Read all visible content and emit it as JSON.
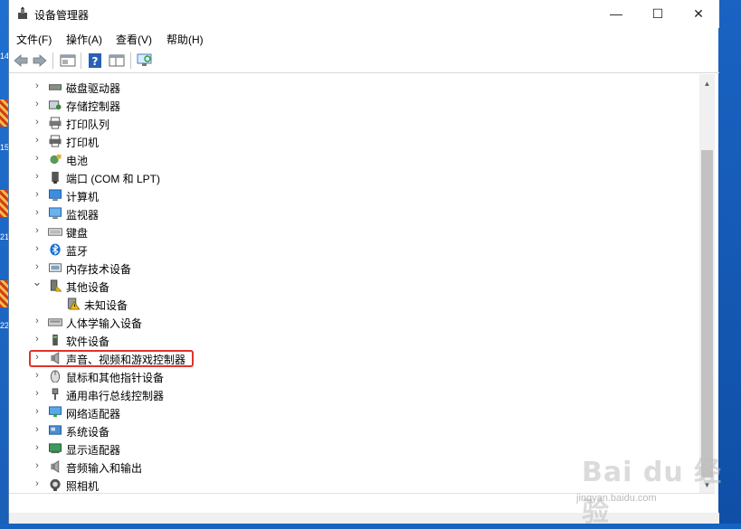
{
  "window": {
    "title": "设备管理器",
    "controls": {
      "minimize": "—",
      "maximize": "☐",
      "close": "✕"
    }
  },
  "menu": [
    {
      "label": "文件(F)"
    },
    {
      "label": "操作(A)"
    },
    {
      "label": "查看(V)"
    },
    {
      "label": "帮助(H)"
    }
  ],
  "toolbar": {
    "icons": [
      "back-arrow-icon",
      "forward-arrow-icon",
      "properties-icon",
      "help-icon",
      "console-view-icon",
      "scan-hardware-icon"
    ]
  },
  "tree": [
    {
      "label": "磁盘驱动器",
      "icon": "disk-drive-icon",
      "expanded": false
    },
    {
      "label": "存储控制器",
      "icon": "storage-controller-icon",
      "expanded": false
    },
    {
      "label": "打印队列",
      "icon": "print-queue-icon",
      "expanded": false
    },
    {
      "label": "打印机",
      "icon": "printer-icon",
      "expanded": false
    },
    {
      "label": "电池",
      "icon": "battery-icon",
      "expanded": false
    },
    {
      "label": "端口 (COM 和 LPT)",
      "icon": "port-icon",
      "expanded": false
    },
    {
      "label": "计算机",
      "icon": "computer-icon",
      "expanded": false
    },
    {
      "label": "监视器",
      "icon": "monitor-icon",
      "expanded": false
    },
    {
      "label": "键盘",
      "icon": "keyboard-icon",
      "expanded": false
    },
    {
      "label": "蓝牙",
      "icon": "bluetooth-icon",
      "expanded": false
    },
    {
      "label": "内存技术设备",
      "icon": "memory-device-icon",
      "expanded": false
    },
    {
      "label": "其他设备",
      "icon": "other-device-icon",
      "expanded": true
    },
    {
      "label": "未知设备",
      "icon": "unknown-device-warning-icon",
      "child": true
    },
    {
      "label": "人体学输入设备",
      "icon": "hid-icon",
      "expanded": false
    },
    {
      "label": "软件设备",
      "icon": "software-device-icon",
      "expanded": false
    },
    {
      "label": "声音、视频和游戏控制器",
      "icon": "speaker-icon",
      "expanded": false,
      "highlighted": true
    },
    {
      "label": "鼠标和其他指针设备",
      "icon": "mouse-icon",
      "expanded": false
    },
    {
      "label": "通用串行总线控制器",
      "icon": "usb-icon",
      "expanded": false
    },
    {
      "label": "网络适配器",
      "icon": "network-adapter-icon",
      "expanded": false
    },
    {
      "label": "系统设备",
      "icon": "system-device-icon",
      "expanded": false
    },
    {
      "label": "显示适配器",
      "icon": "display-adapter-icon",
      "expanded": false
    },
    {
      "label": "音频输入和输出",
      "icon": "audio-io-icon",
      "expanded": false
    },
    {
      "label": "照相机",
      "icon": "camera-icon",
      "expanded": false
    }
  ],
  "watermark": {
    "text": "Bai du 经验",
    "url": "jingyan.baidu.com"
  },
  "desktop_labels": [
    "14",
    "15",
    "21",
    "22"
  ],
  "colors": {
    "highlight_border": "#e0332a",
    "scroll_thumb": "#c2c2c2"
  }
}
